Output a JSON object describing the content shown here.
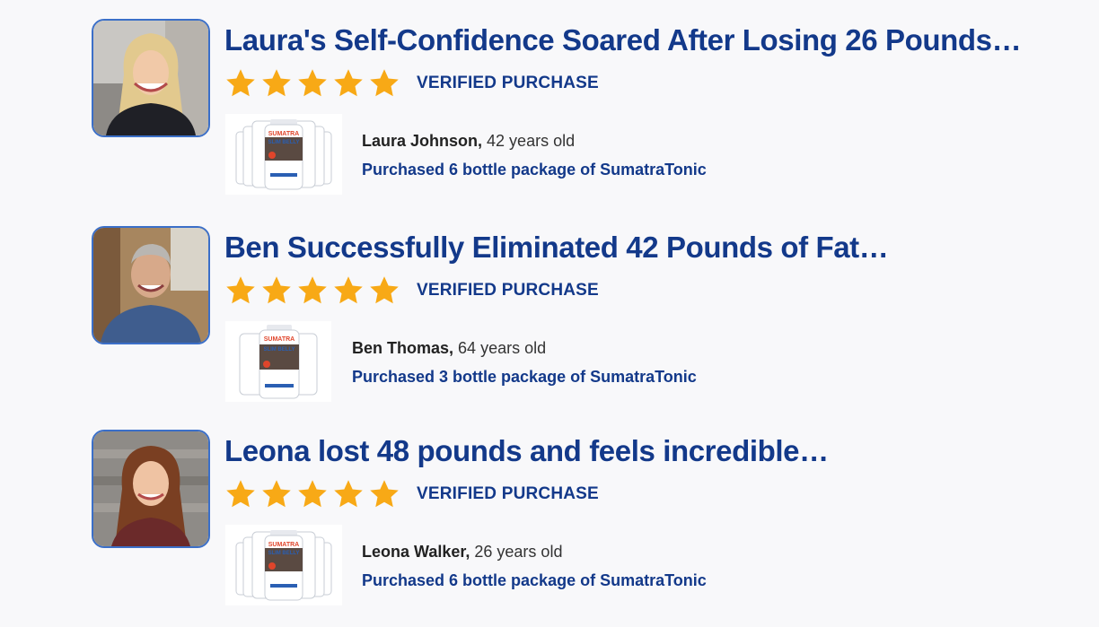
{
  "reviews": [
    {
      "headline": "Laura's Self-Confidence Soared After Losing 26 Pounds…",
      "rating": 5,
      "verified_label": "VERIFIED PURCHASE",
      "buyer_name": "Laura Johnson,",
      "buyer_age": "42 years old",
      "purchase_text": "Purchased 6 bottle package of SumatraTonic",
      "bottle_count": 6
    },
    {
      "headline": "Ben Successfully Eliminated 42 Pounds of Fat…",
      "rating": 5,
      "verified_label": "VERIFIED PURCHASE",
      "buyer_name": "Ben Thomas,",
      "buyer_age": "64 years old",
      "purchase_text": "Purchased 3 bottle package of SumatraTonic",
      "bottle_count": 3
    },
    {
      "headline": "Leona lost 48 pounds and feels incredible…",
      "rating": 5,
      "verified_label": "VERIFIED PURCHASE",
      "buyer_name": "Leona Walker,",
      "buyer_age": "26 years old",
      "purchase_text": "Purchased 6 bottle package of SumatraTonic",
      "bottle_count": 6
    }
  ],
  "product_label": {
    "line1": "SUMATRA",
    "line2": "SLIM BELLY"
  },
  "colors": {
    "headline": "#13398a",
    "star": "#f8a916",
    "avatar_border": "#3b6fc8",
    "background": "#f8f8fa"
  }
}
